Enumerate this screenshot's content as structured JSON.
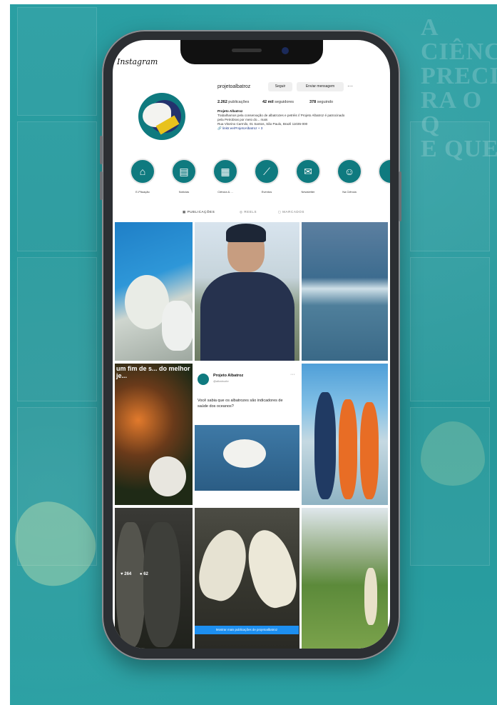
{
  "background": {
    "color": "#2a9a9d",
    "text_lines": [
      "A CIÊNC",
      "PRECIS",
      "RA O Q",
      "E QUE"
    ]
  },
  "instagram": {
    "logo_text": "Instagram",
    "username": "projetoalbatroz",
    "follow_button": "Seguir",
    "message_button": "Enviar mensagem",
    "more_label": "···",
    "stats": {
      "posts": "2.262",
      "posts_label": "publicações",
      "followers": "42 mil",
      "followers_label": "seguidores",
      "following": "378",
      "following_label": "seguindo"
    },
    "bio": {
      "name": "Projeto Albatroz",
      "line1": "Trabalhamos pela conservação de albatrozes e petréis // Projeto Albatroz é patrocinado",
      "line2": "pela Petrobras por meio do... mais",
      "line3": "Rua Vitorino Carmilo, 01 Santos, São Paulo, Brazil 11035-000",
      "link": "🔗 linktr.ee/ProjetoAlbatroz + 3"
    },
    "highlights": [
      {
        "label": "E-Pituação",
        "icon": "home-icon"
      },
      {
        "label": "Notícias",
        "icon": "document-icon"
      },
      {
        "label": "Ciência & ...",
        "icon": "chart-icon"
      },
      {
        "label": "Eventos",
        "icon": "hook-icon"
      },
      {
        "label": "Newsletter",
        "icon": "envelope-icon"
      },
      {
        "label": "Na Ciência",
        "icon": "people-icon"
      }
    ],
    "tabs": {
      "posts": "▦ PUBLICAÇÕES",
      "reels": "◎ REELS",
      "tagged": "◻ MARCADOS"
    },
    "posts": [
      {
        "alt": "albatross-chick"
      },
      {
        "alt": "researcher-portrait"
      },
      {
        "alt": "ocean-bird"
      },
      {
        "overlay": "um fim de s... do melhor je..."
      },
      {
        "card_name": "Projeto Albatroz",
        "card_handle": "@albatrozbr",
        "card_text": "Você sabia que os albatrozes são indicadores de saúde dos oceanos?",
        "card_dots": "···"
      },
      {
        "alt": "team-selfie"
      },
      {
        "likes": "264",
        "comments": "62",
        "alt": "two-men"
      },
      {
        "alt": "waved-albatrosses"
      },
      {
        "alt": "garden-person"
      }
    ],
    "more_posts": "Mostrar mais publicações de projetoalbatroz"
  }
}
